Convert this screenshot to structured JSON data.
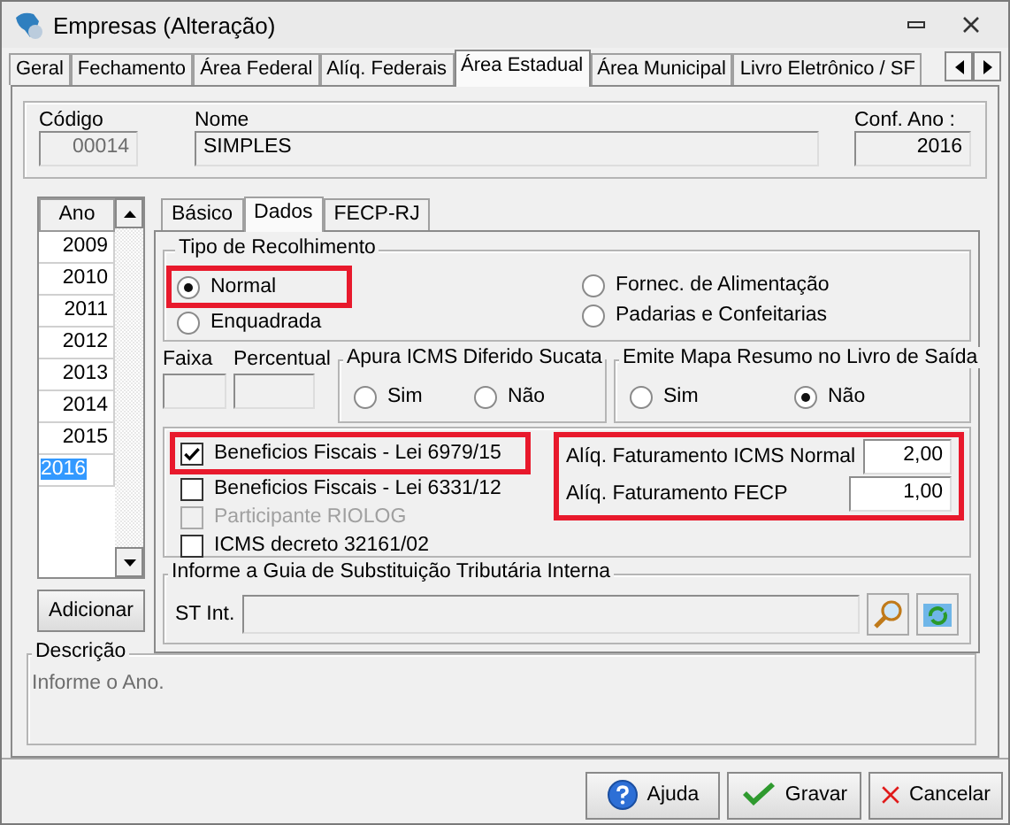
{
  "window": {
    "title": "Empresas (Alteração)"
  },
  "tabs": [
    {
      "label": "Geral",
      "selected": false
    },
    {
      "label": "Fechamento",
      "selected": false
    },
    {
      "label": "Área Federal",
      "selected": false
    },
    {
      "label": "Alíq. Federais",
      "selected": false
    },
    {
      "label": "Área Estadual",
      "selected": true
    },
    {
      "label": "Área Municipal",
      "selected": false
    },
    {
      "label": "Livro Eletrônico / SF",
      "selected": false
    }
  ],
  "header": {
    "code_label": "Código",
    "code": "00014",
    "name_label": "Nome",
    "name": "SIMPLES",
    "year_label": "Conf. Ano :",
    "year": "2016"
  },
  "years": {
    "header": "Ano",
    "items": [
      {
        "label": "2009",
        "selected": false
      },
      {
        "label": "2010",
        "selected": false
      },
      {
        "label": "2011",
        "selected": false
      },
      {
        "label": "2012",
        "selected": false
      },
      {
        "label": "2013",
        "selected": false
      },
      {
        "label": "2014",
        "selected": false
      },
      {
        "label": "2015",
        "selected": false
      },
      {
        "label": "2016",
        "selected": true
      }
    ],
    "add_button": "Adicionar"
  },
  "subtabs": [
    {
      "label": "Básico",
      "selected": false
    },
    {
      "label": "Dados",
      "selected": true
    },
    {
      "label": "FECP-RJ",
      "selected": false
    }
  ],
  "tipo_recolhimento": {
    "title": "Tipo de Recolhimento",
    "options": [
      {
        "label": "Normal",
        "selected": true,
        "highlighted": true
      },
      {
        "label": "Enquadrada",
        "selected": false,
        "highlighted": false
      },
      {
        "label": "Fornec. de Alimentação",
        "selected": false,
        "highlighted": false
      },
      {
        "label": "Padarias e Confeitarias",
        "selected": false,
        "highlighted": false
      }
    ]
  },
  "faixa": {
    "label": "Faixa"
  },
  "percentual": {
    "label": "Percentual"
  },
  "apura_icms": {
    "title": "Apura ICMS Diferido Sucata",
    "options": [
      {
        "label": "Sim",
        "selected": false
      },
      {
        "label": "Não",
        "selected": false
      }
    ]
  },
  "emite_mapa": {
    "title": "Emite Mapa Resumo no Livro de Saída",
    "options": [
      {
        "label": "Sim",
        "selected": false
      },
      {
        "label": "Não",
        "selected": true
      }
    ]
  },
  "checkboxes": [
    {
      "label": "Beneficios Fiscais - Lei 6979/15",
      "checked": true,
      "disabled": false,
      "highlighted": true
    },
    {
      "label": "Beneficios Fiscais - Lei 6331/12",
      "checked": false,
      "disabled": false,
      "highlighted": false
    },
    {
      "label": "Participante RIOLOG",
      "checked": false,
      "disabled": true,
      "highlighted": false
    },
    {
      "label": "ICMS decreto 32161/02",
      "checked": false,
      "disabled": false,
      "highlighted": false
    }
  ],
  "aliquotas": {
    "highlighted": true,
    "rows": [
      {
        "label": "Alíq. Faturamento ICMS Normal",
        "value": "2,00"
      },
      {
        "label": "Alíq. Faturamento FECP",
        "value": "1,00"
      }
    ]
  },
  "st_interna": {
    "title": "Informe a Guia de Substituição Tributária Interna",
    "label": "ST Int."
  },
  "descricao": {
    "title": "Descrição",
    "text": "Informe o Ano."
  },
  "buttons": [
    {
      "label": "Ajuda",
      "kind": "help"
    },
    {
      "label": "Gravar",
      "kind": "save"
    },
    {
      "label": "Cancelar",
      "kind": "cancel"
    }
  ]
}
